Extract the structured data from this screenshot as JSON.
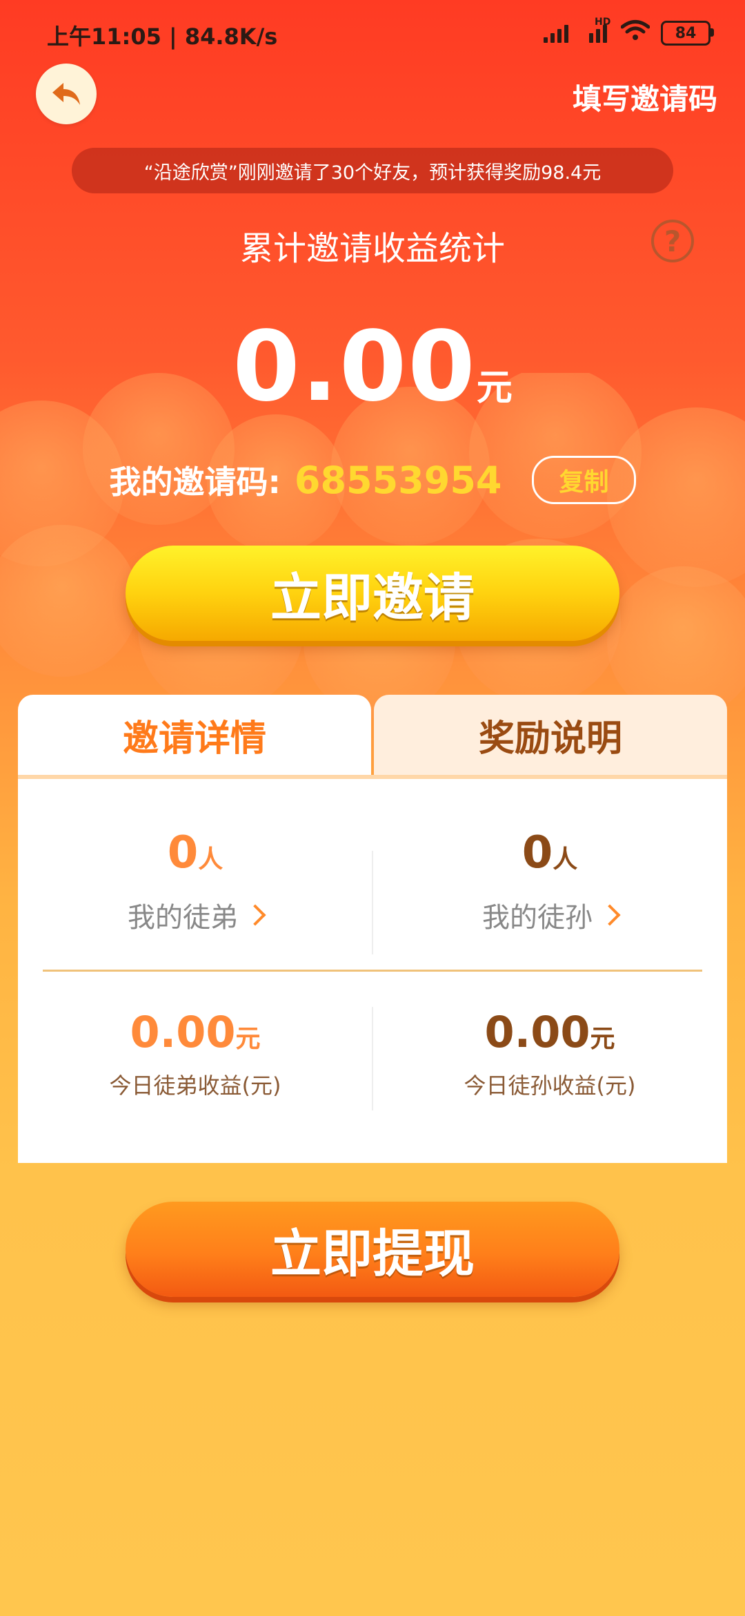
{
  "status_bar": {
    "time_speed": "上午11:05 | 84.8K/s",
    "hd_label": "HD",
    "battery_level": "84"
  },
  "header": {
    "back_icon": "back-arrow-icon",
    "fill_invite_code": "填写邀请码"
  },
  "ticker": {
    "text": "“沿途欣赏”刚刚邀请了30个好友，预计获得奖励98.4元"
  },
  "stats": {
    "title": "累计邀请收益统计",
    "help_icon": "question-circle-icon",
    "help_symbol": "?",
    "total_amount": "0.00",
    "total_unit": "元"
  },
  "invite_code": {
    "label": "我的邀请码:",
    "value": "68553954",
    "copy_label": "复制"
  },
  "buttons": {
    "invite_now": "立即邀请",
    "withdraw_now": "立即提现"
  },
  "tabs": [
    {
      "label": "邀请详情",
      "active": true
    },
    {
      "label": "奖励说明",
      "active": false
    }
  ],
  "details": {
    "apprentices": {
      "count": "0",
      "unit": "人",
      "label": "我的徒弟"
    },
    "grand_apprentices": {
      "count": "0",
      "unit": "人",
      "label": "我的徒孙"
    },
    "today_apprentice_earnings": {
      "amount": "0.00",
      "unit": "元",
      "label": "今日徒弟收益(元)"
    },
    "today_grand_apprentice_earnings": {
      "amount": "0.00",
      "unit": "元",
      "label": "今日徒孙收益(元)"
    }
  },
  "colors": {
    "accent_orange": "#ff7a1a",
    "code_yellow": "#ffd830",
    "brown": "#8b4a17"
  }
}
